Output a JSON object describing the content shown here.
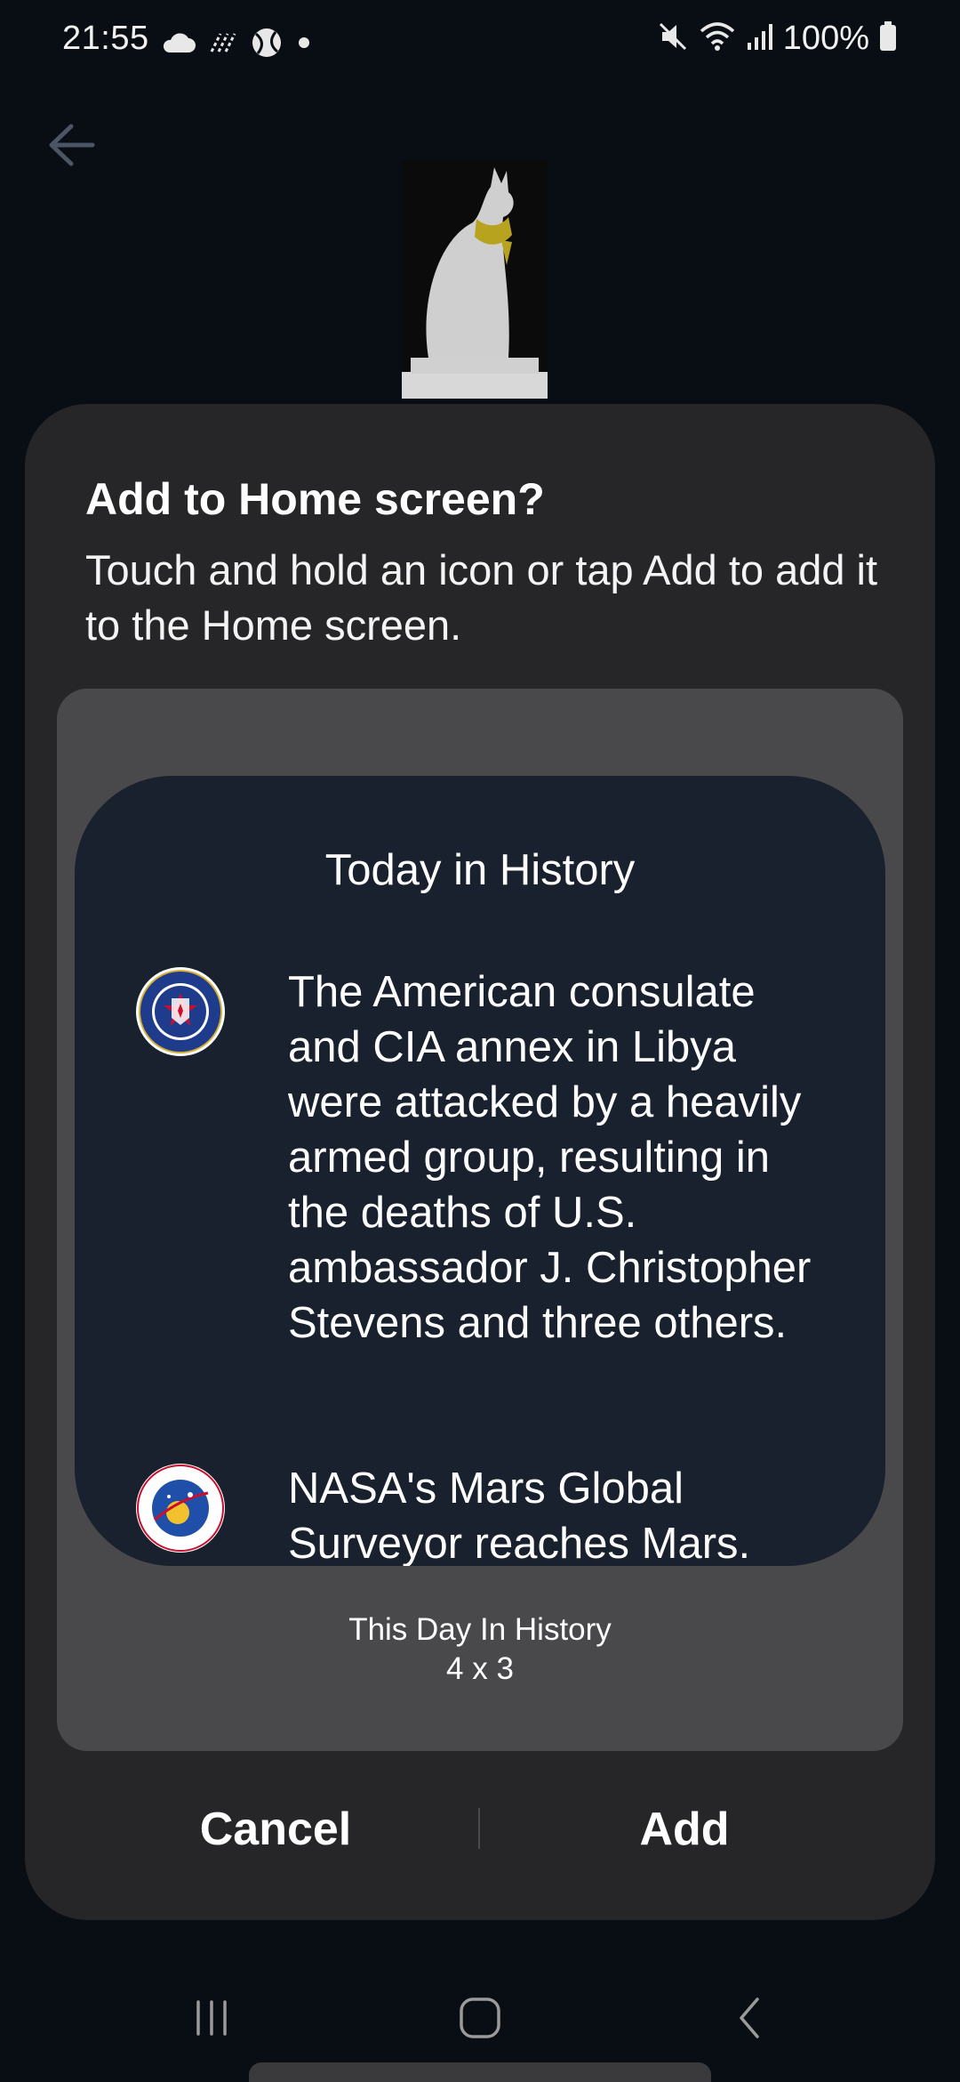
{
  "status_bar": {
    "time": "21:55",
    "battery": "100%",
    "icons": [
      "cloud-icon",
      "signal-activity-icon",
      "sports-ball-icon",
      "notification-dot-icon",
      "mute-icon",
      "wifi-icon",
      "cellular-signal-icon",
      "battery-icon"
    ]
  },
  "background": {
    "back_icon": "back-arrow-icon",
    "image": "cat-statue-image"
  },
  "dialog": {
    "title": "Add to Home screen?",
    "message": "Touch and hold an icon or tap Add to add it to the Home screen.",
    "widget": {
      "title": "Today in History",
      "events": [
        {
          "icon": "cia-seal-icon",
          "text": "The American consulate and CIA annex in Libya were attacked by a heavily armed group, resulting in the deaths of U.S. ambassador J. Christopher Stevens and three others."
        },
        {
          "icon": "nasa-seal-icon",
          "text": "NASA's Mars Global Surveyor reaches Mars."
        }
      ],
      "name": "This Day In History",
      "size": "4 x 3"
    },
    "cancel_label": "Cancel",
    "add_label": "Add"
  },
  "nav_bar": {
    "icons": [
      "recents-icon",
      "home-icon",
      "back-icon"
    ]
  },
  "colors": {
    "page_background": "#090d14",
    "dialog_background": "#262628",
    "preview_background": "#49494b",
    "widget_background": "#18212d",
    "text": "#ffffff"
  }
}
